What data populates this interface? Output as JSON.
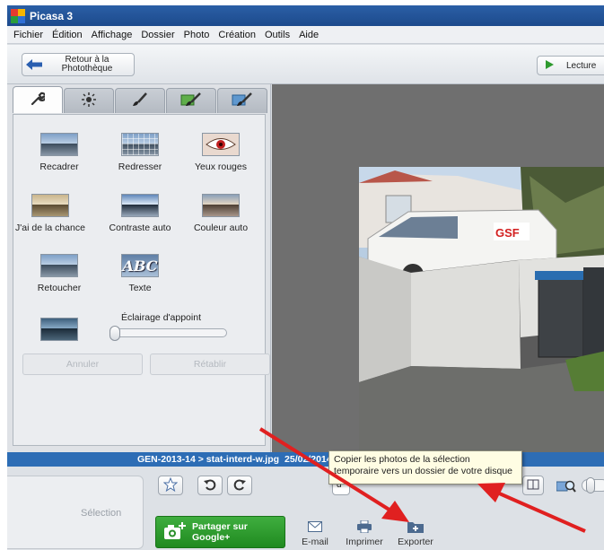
{
  "window": {
    "title": "Picasa 3"
  },
  "menu": {
    "items": [
      "Fichier",
      "Édition",
      "Affichage",
      "Dossier",
      "Photo",
      "Création",
      "Outils",
      "Aide"
    ]
  },
  "toolbar": {
    "back_label": "Retour à la Photothèque",
    "play_label": "Lecture"
  },
  "tools": {
    "tabs": [
      "wrench-icon",
      "sun-icon",
      "brush-icon",
      "green-brush-icon",
      "blue-brush-icon"
    ],
    "items": [
      "Recadrer",
      "Redresser",
      "Yeux rouges",
      "J'ai de la chance",
      "Contraste auto",
      "Couleur auto",
      "Retoucher",
      "Texte"
    ],
    "text_thumb": "ABC",
    "slider_label": "Éclairage d'appoint",
    "undo_label": "Annuler",
    "redo_label": "Rétablir"
  },
  "status": {
    "path": "GEN-2013-14 > stat-interd-w.jpg",
    "date": "25/02/2014 1"
  },
  "bottom": {
    "selection_label": "Sélection",
    "share_label": "Partager sur Google+",
    "actions": [
      "E-mail",
      "Imprimer",
      "Exporter"
    ],
    "zoom_value": "d"
  },
  "tooltip": {
    "line1": "Copier les photos de la sélection",
    "line2": "temporaire vers un dossier de votre disque"
  },
  "colors": {
    "accent": "#2d6db5",
    "share": "#2f9d2f",
    "arrow": "#e02020"
  }
}
